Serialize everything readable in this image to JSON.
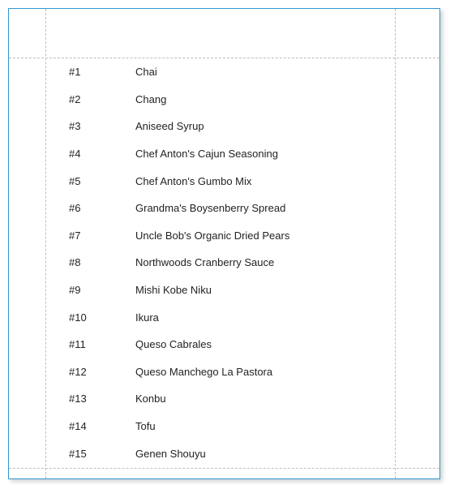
{
  "products": [
    {
      "idx": "#1",
      "name": "Chai"
    },
    {
      "idx": "#2",
      "name": "Chang"
    },
    {
      "idx": "#3",
      "name": "Aniseed Syrup"
    },
    {
      "idx": "#4",
      "name": "Chef Anton's Cajun Seasoning"
    },
    {
      "idx": "#5",
      "name": "Chef Anton's Gumbo Mix"
    },
    {
      "idx": "#6",
      "name": "Grandma's Boysenberry Spread"
    },
    {
      "idx": "#7",
      "name": "Uncle Bob's Organic Dried Pears"
    },
    {
      "idx": "#8",
      "name": "Northwoods Cranberry Sauce"
    },
    {
      "idx": "#9",
      "name": "Mishi Kobe Niku"
    },
    {
      "idx": "#10",
      "name": "Ikura"
    },
    {
      "idx": "#11",
      "name": "Queso Cabrales"
    },
    {
      "idx": "#12",
      "name": "Queso Manchego La Pastora"
    },
    {
      "idx": "#13",
      "name": "Konbu"
    },
    {
      "idx": "#14",
      "name": "Tofu"
    },
    {
      "idx": "#15",
      "name": "Genen Shouyu"
    }
  ]
}
